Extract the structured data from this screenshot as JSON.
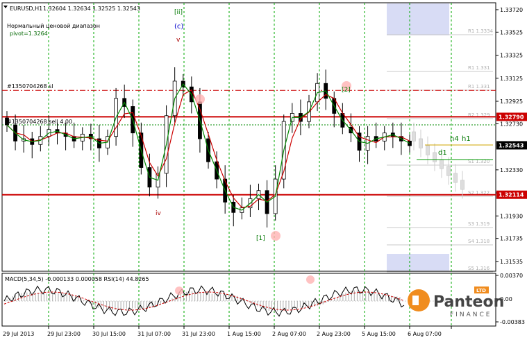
{
  "header": {
    "symbol": "EURUSD,H1",
    "ohlc": "1.32604 1.32634 1.32525 1.32543",
    "indicator_name": "Нормальный ценовой диапазон",
    "pivot": "pivot=1.3264"
  },
  "order_lines": {
    "sl_label": "#1350704268 sl",
    "sell_label": "#1350704268 sell 4.00"
  },
  "wave_labels": [
    "[ii]",
    "(c)",
    "v",
    "iv",
    "[1]",
    "[2]",
    "h4",
    "h1",
    "d1"
  ],
  "pivot_labels": [
    "R1 1.3334",
    "R1 1.331",
    "R1 1.331",
    "R2 1.329",
    "S1 1.320",
    "S2 1.322",
    "S3 1.319",
    "S4 1.318",
    "S5 1.316"
  ],
  "price_axis": {
    "ticks": [
      "1.33720",
      "1.33525",
      "1.33325",
      "1.33125",
      "1.32925",
      "1.32730",
      "1.32330",
      "1.32130",
      "1.31930",
      "1.31735",
      "1.31535"
    ],
    "tick_values": [
      1.3372,
      1.33525,
      1.33325,
      1.33125,
      1.32925,
      1.3273,
      1.3233,
      1.3213,
      1.3193,
      1.31735,
      1.31535
    ],
    "highlight_upper": "1.32790",
    "highlight_upper_value": 1.3279,
    "current": "1.32543",
    "current_value": 1.32543,
    "highlight_lower": "1.32114",
    "highlight_lower_value": 1.32114,
    "highlight_color": "#cc0000",
    "current_color": "#000000"
  },
  "time_axis": [
    "29 Jul 2013",
    "29 Jul 23:00",
    "30 Jul 15:00",
    "31 Jul 07:00",
    "31 Jul 23:00",
    "1 Aug 15:00",
    "2 Aug 07:00",
    "2 Aug 23:00",
    "5 Aug 15:00",
    "6 Aug 07:00"
  ],
  "sub_window": {
    "label": "MACD(5,34,5) -0.000133 0.000058  RSI(14) 44.8265",
    "ticks": [
      "0.00370",
      "0.00",
      "-0.00383"
    ]
  },
  "logo": {
    "name": "Panteon",
    "sub": "FINANCE",
    "badge": "LTD"
  },
  "colors": {
    "bull": "#000000",
    "bear": "#000000",
    "ma_fast": "#cc0000",
    "ma_slow": "#008800",
    "level": "#cc0000",
    "grid": "#00aa00",
    "wave_blue": "#0000cc",
    "wave_green": "#007700",
    "wave_red": "#aa0000",
    "logo_orange": "#f08c1e"
  },
  "chart_data": {
    "type": "candlestick",
    "title": "EURUSD,H1",
    "ylim": [
      1.3145,
      1.3378
    ],
    "levels": [
      1.3279,
      1.32114
    ],
    "order_levels": [
      1.3302,
      1.3272
    ],
    "x": [
      "29 Jul 2013",
      "29 Jul 23:00",
      "30 Jul 15:00",
      "31 Jul 07:00",
      "31 Jul 23:00",
      "1 Aug 15:00",
      "2 Aug 07:00",
      "2 Aug 23:00",
      "5 Aug 15:00",
      "6 Aug 07:00"
    ],
    "close": [
      1.3272,
      1.3258,
      1.326,
      1.3255,
      1.3262,
      1.3268,
      1.3265,
      1.3262,
      1.3258,
      1.3264,
      1.326,
      1.3252,
      1.3262,
      1.3295,
      1.3288,
      1.3265,
      1.3235,
      1.3218,
      1.323,
      1.328,
      1.331,
      1.3305,
      1.3292,
      1.326,
      1.324,
      1.3225,
      1.3205,
      1.3196,
      1.32,
      1.3208,
      1.3215,
      1.3195,
      1.3225,
      1.3275,
      1.3282,
      1.3275,
      1.3292,
      1.3308,
      1.3295,
      1.3282,
      1.327,
      1.3265,
      1.325,
      1.3262,
      1.3258,
      1.3265,
      1.3262,
      1.3258,
      1.3254
    ],
    "macd_range": [
      -0.00383,
      0.0037
    ]
  }
}
